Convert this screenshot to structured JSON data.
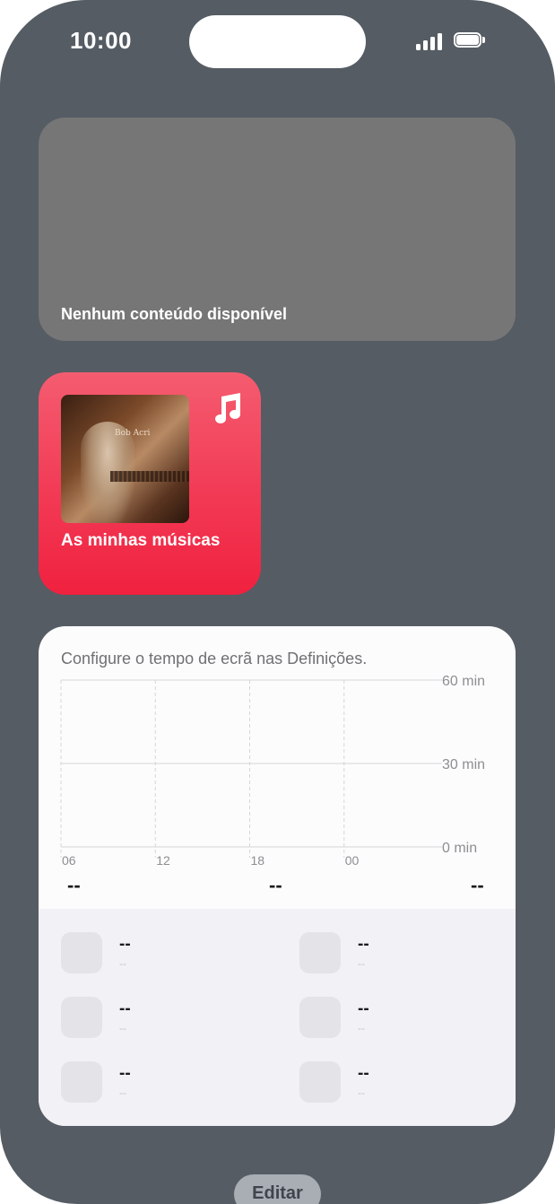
{
  "status_bar": {
    "time": "10:00"
  },
  "widgets": {
    "empty_widget": {
      "message": "Nenhum conteúdo disponível"
    },
    "music_widget": {
      "title": "As minhas músicas",
      "album_cover_text": "Bob Acri",
      "icon": "music-note-icon"
    },
    "screen_time_widget": {
      "message": "Configure o tempo de ecrã nas Definições.",
      "summary": [
        "--",
        "--",
        "--"
      ],
      "apps": [
        {
          "name": "--",
          "time": "--"
        },
        {
          "name": "--",
          "time": "--"
        },
        {
          "name": "--",
          "time": "--"
        },
        {
          "name": "--",
          "time": "--"
        },
        {
          "name": "--",
          "time": "--"
        },
        {
          "name": "--",
          "time": "--"
        }
      ]
    }
  },
  "chart_data": {
    "type": "bar",
    "categories": [
      "06",
      "12",
      "18",
      "00"
    ],
    "series": [],
    "y_ticks": [
      "60 min",
      "30 min",
      "0 min"
    ],
    "ylim": [
      0,
      60
    ],
    "grid": true
  },
  "edit_button": {
    "label": "Editar"
  },
  "colors": {
    "background": "#555c64",
    "music_accent": "#f23a55",
    "empty_widget": "#767677",
    "screen_widget": "#fcfcfc"
  }
}
